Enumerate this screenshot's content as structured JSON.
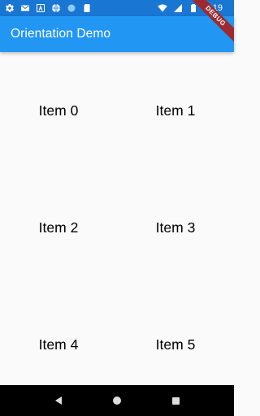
{
  "status_bar": {
    "time": "5:19",
    "left_icons": [
      "settings-icon",
      "gmail-icon",
      "a-icon",
      "sports-ball-icon",
      "circle-icon",
      "sd-card-icon"
    ],
    "right_icons": [
      "wifi-icon",
      "signal-icon",
      "battery-icon"
    ],
    "color": "#1976d2"
  },
  "app_bar": {
    "title": "Orientation Demo",
    "color": "#2196f3"
  },
  "debug_banner": {
    "label": "DEBUG",
    "color": "#9e2a2f"
  },
  "grid": {
    "items": [
      {
        "label": "Item 0"
      },
      {
        "label": "Item 1"
      },
      {
        "label": "Item 2"
      },
      {
        "label": "Item 3"
      },
      {
        "label": "Item 4"
      },
      {
        "label": "Item 5"
      }
    ]
  },
  "nav_bar": {
    "buttons": [
      "back-icon",
      "home-icon",
      "recents-icon"
    ]
  }
}
